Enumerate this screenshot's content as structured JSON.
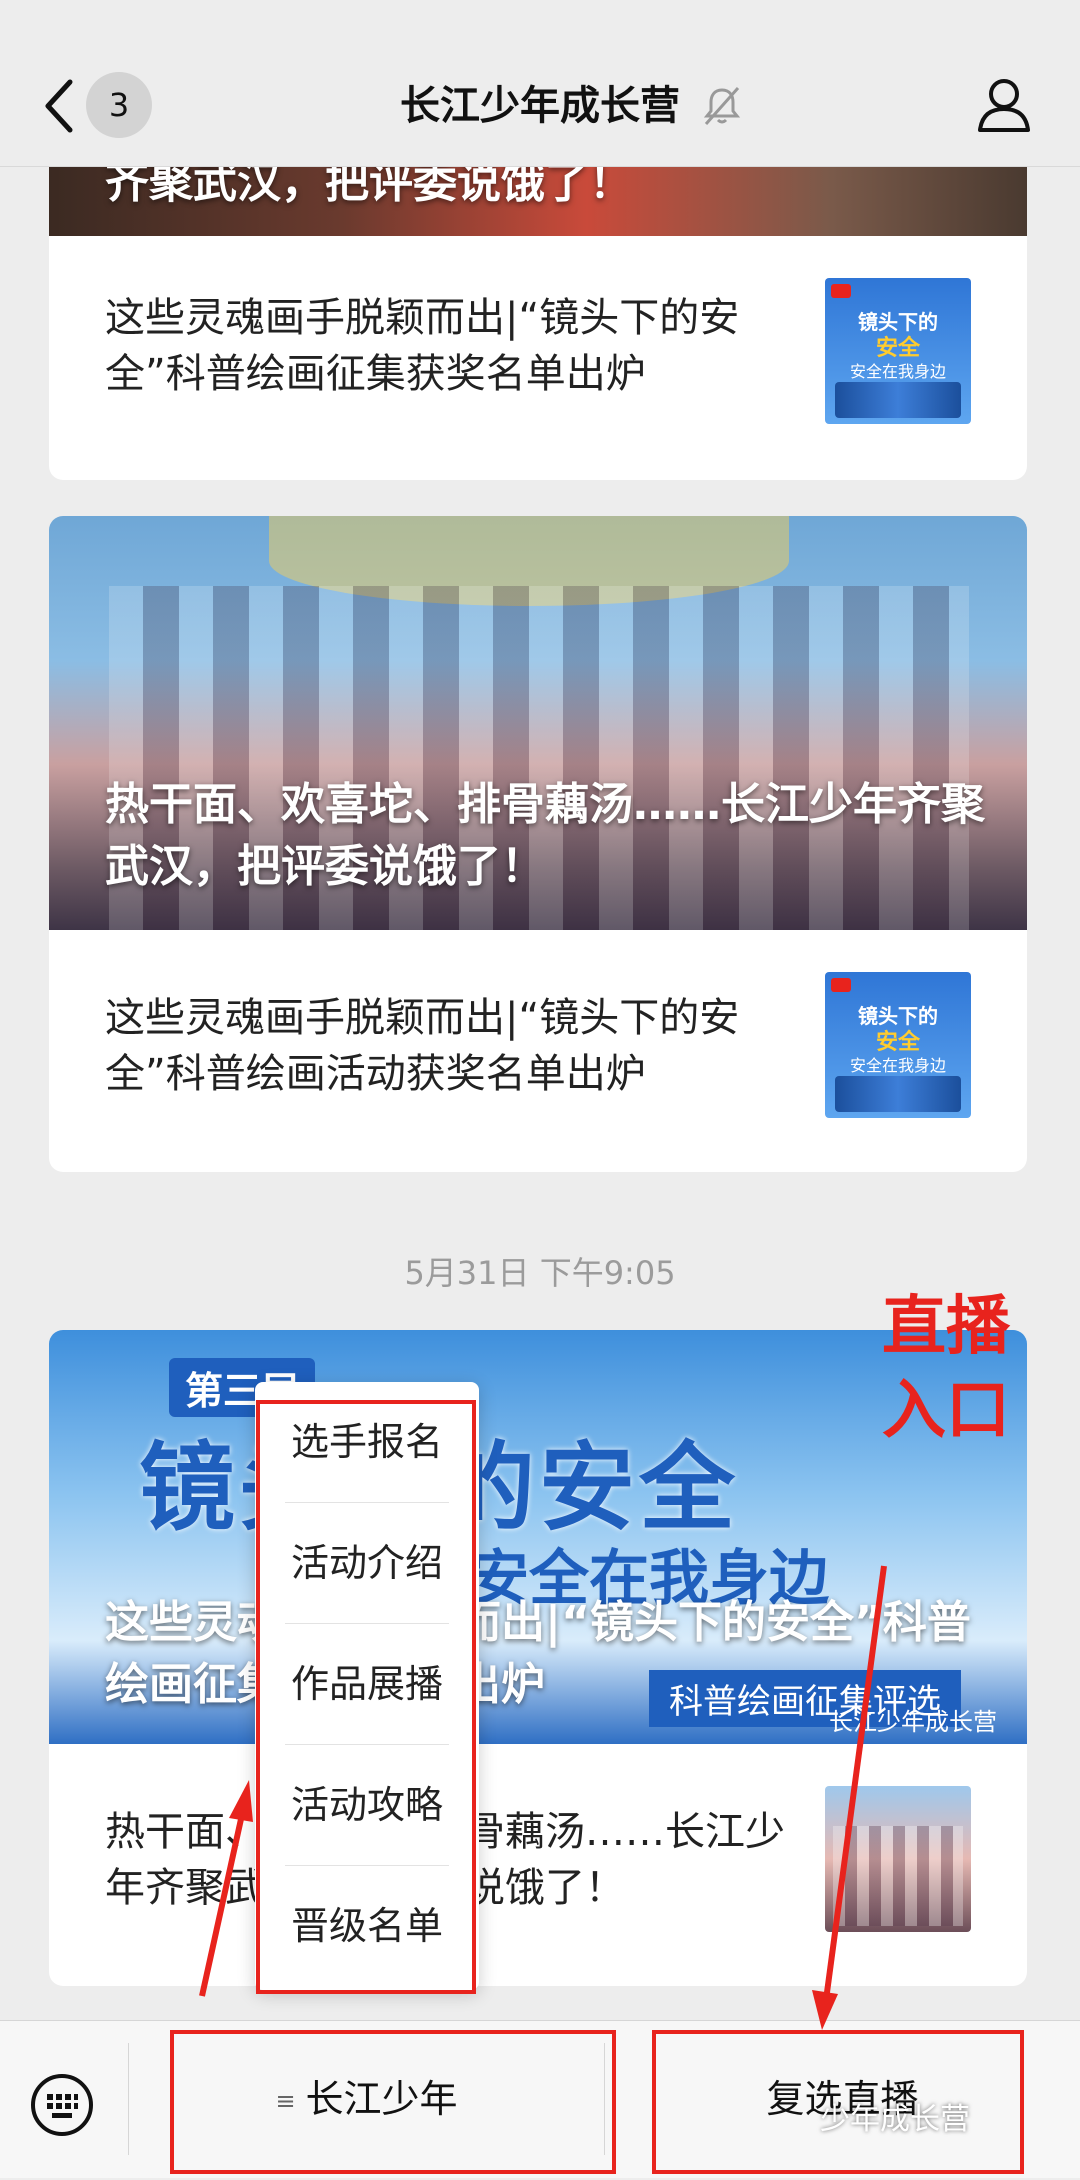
{
  "header": {
    "back_label": "",
    "unread_count": "3",
    "title": "长江少年成长营"
  },
  "cards": [
    {
      "cover_title": "齐聚武汉，把评委说饿了！",
      "row_text": "这些灵魂画手脱颖而出|“镜头下的安全”科普绘画征集获奖名单出炉"
    },
    {
      "cover_title": "热干面、欢喜坨、排骨藕汤……长江少年齐聚武汉，把评委说饿了！",
      "row_text": "这些灵魂画手脱颖而出|“镜头下的安全”科普绘画活动获奖名单出炉"
    },
    {
      "cover_title": "这些灵魂画手脱颖而出|“镜头下的安全”科普绘画征集获奖名单出炉",
      "cover_banner_1": "第三届",
      "cover_banner_2": "镜头下的安全",
      "cover_banner_3": "安全在我身边",
      "cover_banner_4": "科普绘画征集评选",
      "cover_watermark": "长江少年成长营",
      "row_text": "热干面、欢喜坨、排骨藕汤……长江少年齐聚武汉，把评委说饿了！"
    }
  ],
  "thumb": {
    "line1": "镜头下的",
    "line2": "安全",
    "line3": "安全在我身边"
  },
  "timestamp": "5月31日 下午9:05",
  "annotation": {
    "live_label_1": "直播",
    "live_label_2": "入口"
  },
  "menu": {
    "items": [
      "选手报名",
      "活动介绍",
      "作品展播",
      "活动攻略",
      "晋级名单"
    ]
  },
  "bottom": {
    "tab1_label": "长江少年",
    "tab2_label": "复选直播",
    "watermark": "少年成长营"
  },
  "colors": {
    "annotation_red": "#e8231d",
    "background": "#ededed"
  }
}
